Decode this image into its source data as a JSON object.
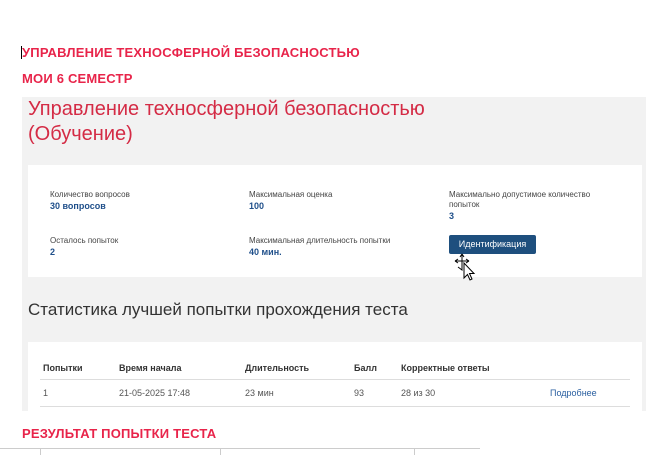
{
  "document": {
    "heading1": "УПРАВЛЕНИЕ ТЕХНОСФЕРНОЙ БЕЗОПАСНОСТЬЮ",
    "heading2": "МОИ 6 СЕМЕСТР",
    "heading3": "РЕЗУЛЬТАТ ПОПЫТКИ ТЕСТА"
  },
  "screenshot": {
    "title_line1": "Управление техносферной безопасностью",
    "title_line2": "(Обучение)",
    "info": {
      "questions_label": "Количество вопросов",
      "questions_value": "30 вопросов",
      "max_score_label": "Максимальная оценка",
      "max_score_value": "100",
      "max_attempts_label": "Максимально допустимое количество попыток",
      "max_attempts_value": "3",
      "remaining_label": "Осталось попыток",
      "remaining_value": "2",
      "duration_label": "Максимальная длительность попытки",
      "duration_value": "40 мин.",
      "identify_button": "Идентификация"
    },
    "stats_title": "Статистика лучшей попытки прохождения теста",
    "table": {
      "headers": [
        "Попытки",
        "Время начала",
        "Длительность",
        "Балл",
        "Корректные ответы"
      ],
      "rows": [
        [
          "1",
          "21-05-2025 17:48",
          "23 мин",
          "93",
          "28 из 30",
          "Подробнее"
        ]
      ]
    }
  },
  "colors": {
    "heading_red": "#e8244a",
    "title_red": "#d42b45",
    "value_blue": "#1f4f8a",
    "button_blue": "#1e4f7e"
  }
}
